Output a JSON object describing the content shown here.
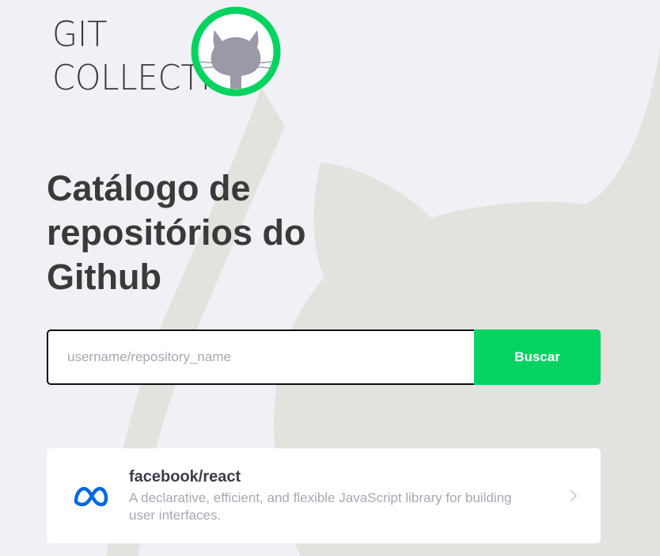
{
  "logo": {
    "line1": "GIT",
    "line2": "COLLECTION",
    "badge_icon": "octocat-icon",
    "badge_ring_color": "#04d361"
  },
  "hero": {
    "title": "Catálogo de repositórios do Github"
  },
  "search": {
    "placeholder": "username/repository_name",
    "value": "",
    "button_label": "Buscar"
  },
  "repositories": [
    {
      "full_name": "facebook/react",
      "description": "A declarative, efficient, and flexible JavaScript library for building user interfaces.",
      "avatar_icon": "meta-logo-icon",
      "chevron_icon": "chevron-right-icon"
    }
  ],
  "colors": {
    "background": "#f0f0f5",
    "accent": "#04d361",
    "title_text": "#3a3a3a",
    "muted_text": "#a8a8b3",
    "meta_blue": "#0668e1"
  }
}
